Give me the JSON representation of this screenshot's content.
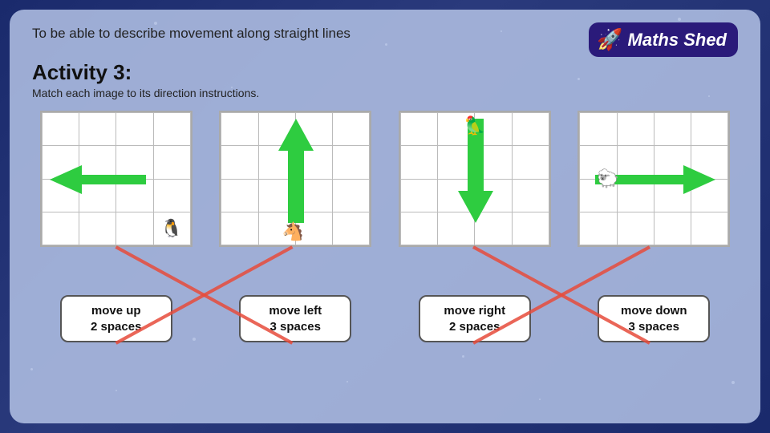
{
  "background": {
    "color": "#1a2a6c"
  },
  "header": {
    "objective": "To be able to describe movement along straight lines",
    "logo": {
      "text": "Maths Shed",
      "icon": "🚀"
    }
  },
  "activity": {
    "title": "Activity 3:",
    "instruction": "Match each image to its direction instructions."
  },
  "panels": [
    {
      "id": "panel1",
      "label_line1": "move up",
      "label_line2": "2 spaces",
      "arrow_direction": "left",
      "animal": "🐧",
      "animal_pos": "bottom-right"
    },
    {
      "id": "panel2",
      "label_line1": "move left",
      "label_line2": "3 spaces",
      "arrow_direction": "up",
      "animal": "🐴",
      "animal_pos": "bottom-center"
    },
    {
      "id": "panel3",
      "label_line1": "move right",
      "label_line2": "2 spaces",
      "arrow_direction": "down",
      "animal": "🦜",
      "animal_pos": "top-center"
    },
    {
      "id": "panel4",
      "label_line1": "move down",
      "label_line2": "3 spaces",
      "arrow_direction": "right",
      "animal": "🐑",
      "animal_pos": "center-left"
    }
  ],
  "cross_lines": {
    "description": "Red X crossing lines between panels and labels"
  }
}
